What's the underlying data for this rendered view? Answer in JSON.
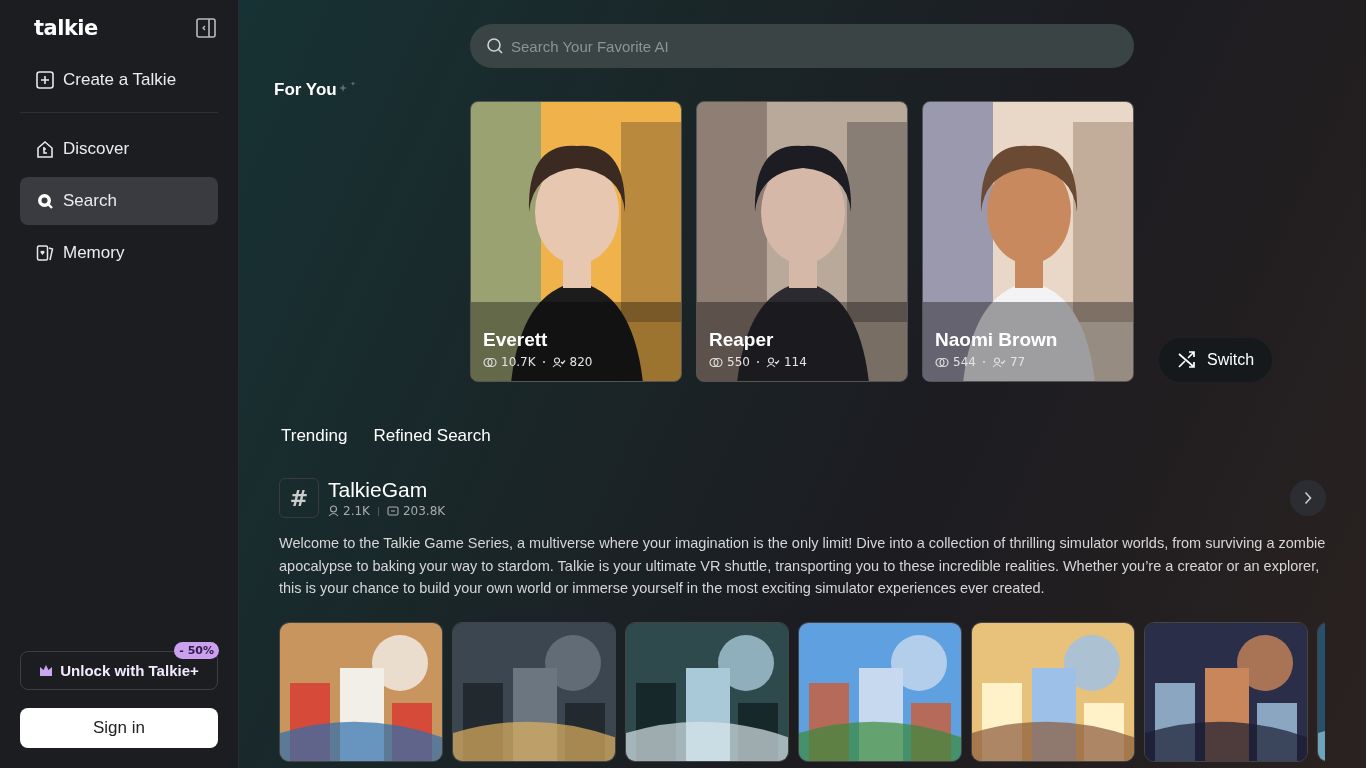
{
  "sidebar": {
    "logo": "talkie",
    "create": "Create a Talkie",
    "items": [
      {
        "label": "Discover",
        "selected": false
      },
      {
        "label": "Search",
        "selected": true
      },
      {
        "label": "Memory",
        "selected": false
      }
    ],
    "unlock": {
      "label": "Unlock with Talkie+",
      "badge": "- 50%"
    },
    "sign_in": "Sign in"
  },
  "search": {
    "placeholder": "Search Your Favorite AI"
  },
  "for_you": {
    "title": "For You",
    "cards": [
      {
        "name": "Everett",
        "chats": "10.7K",
        "followers": "820"
      },
      {
        "name": "Reaper",
        "chats": "550",
        "followers": "114"
      },
      {
        "name": "Naomi Brown",
        "chats": "544",
        "followers": "77"
      }
    ],
    "switch": "Switch"
  },
  "tabs": [
    {
      "label": "Trending",
      "selected": false
    },
    {
      "label": "Refined Search",
      "selected": false
    }
  ],
  "topic": {
    "symbol": "#",
    "title": "TalkieGam",
    "members": "2.1K",
    "messages": "203.8K",
    "description": "Welcome to the Talkie Game Series, a multiverse where your imagination is the only limit! Dive into a collection of thrilling simulator worlds, from surviving a zombie apocalypse to baking your way to stardom. Talkie is your ultimate VR shuttle, transporting you to these incredible realities. Whether you’re a creator or an explorer, this is your chance to build your own world or immerse yourself in the most exciting simulator experiences ever created."
  }
}
